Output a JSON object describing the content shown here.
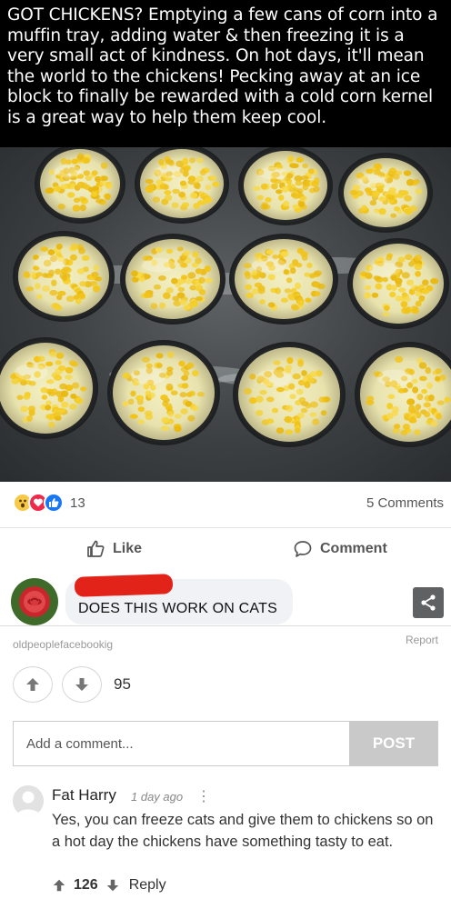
{
  "caption": {
    "text": "GOT CHICKENS? Emptying a few cans of corn into a muffin tray, adding water & then freezing it is a very small act of kindness. On hot days, it'll mean the world to the chickens! Pecking away at an ice block to finally be rewarded with a cold corn kernel is a great way to help them keep cool."
  },
  "photo": {
    "subject": "muffin tray with frozen corn"
  },
  "facebook": {
    "reaction_count": "13",
    "comments_count": "5 Comments",
    "like_label": "Like",
    "comment_label": "Comment",
    "comment_text": "DOES THIS WORK ON CATS",
    "reaction_icons": [
      "wow-icon",
      "love-icon",
      "like-icon"
    ]
  },
  "site": {
    "source": "oldpeoplefacebookig",
    "report_label": "Report",
    "score": "95",
    "comment_placeholder": "Add a comment...",
    "post_label": "POST"
  },
  "user_comment": {
    "name": "Fat Harry",
    "time": "1 day ago",
    "menu": "⋮",
    "text": "Yes, you can freeze cats and give them to chickens so on a hot day the chickens have something tasty to eat.",
    "votes": "126",
    "reply_label": "Reply"
  },
  "colors": {
    "facebook_blue": "#1877f2",
    "redaction_red": "#e2231a",
    "post_button": "#c9c9c9"
  }
}
